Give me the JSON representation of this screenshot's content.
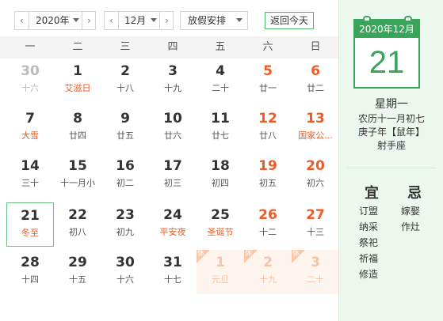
{
  "toolbar": {
    "year": "2020年",
    "month": "12月",
    "holiday_select": "放假安排",
    "today_button": "返回今天",
    "prev_icon": "chevron-left-icon",
    "next_icon": "chevron-right-icon"
  },
  "weekdays": [
    "一",
    "二",
    "三",
    "四",
    "五",
    "六",
    "日"
  ],
  "days": [
    {
      "num": "30",
      "lunar": "十六",
      "type": "other"
    },
    {
      "num": "1",
      "lunar": "艾滋日",
      "type": "festival"
    },
    {
      "num": "2",
      "lunar": "十八",
      "type": "normal"
    },
    {
      "num": "3",
      "lunar": "十九",
      "type": "normal"
    },
    {
      "num": "4",
      "lunar": "二十",
      "type": "normal"
    },
    {
      "num": "5",
      "lunar": "廿一",
      "type": "weekend"
    },
    {
      "num": "6",
      "lunar": "廿二",
      "type": "weekend"
    },
    {
      "num": "7",
      "lunar": "大雪",
      "type": "festival"
    },
    {
      "num": "8",
      "lunar": "廿四",
      "type": "normal"
    },
    {
      "num": "9",
      "lunar": "廿五",
      "type": "normal"
    },
    {
      "num": "10",
      "lunar": "廿六",
      "type": "normal"
    },
    {
      "num": "11",
      "lunar": "廿七",
      "type": "normal"
    },
    {
      "num": "12",
      "lunar": "廿八",
      "type": "weekend"
    },
    {
      "num": "13",
      "lunar": "国家公...",
      "type": "weekend-festival"
    },
    {
      "num": "14",
      "lunar": "三十",
      "type": "normal"
    },
    {
      "num": "15",
      "lunar": "十一月小",
      "type": "normal"
    },
    {
      "num": "16",
      "lunar": "初二",
      "type": "normal"
    },
    {
      "num": "17",
      "lunar": "初三",
      "type": "normal"
    },
    {
      "num": "18",
      "lunar": "初四",
      "type": "normal"
    },
    {
      "num": "19",
      "lunar": "初五",
      "type": "weekend"
    },
    {
      "num": "20",
      "lunar": "初六",
      "type": "weekend"
    },
    {
      "num": "21",
      "lunar": "冬至",
      "type": "today"
    },
    {
      "num": "22",
      "lunar": "初八",
      "type": "normal"
    },
    {
      "num": "23",
      "lunar": "初九",
      "type": "normal"
    },
    {
      "num": "24",
      "lunar": "平安夜",
      "type": "festival"
    },
    {
      "num": "25",
      "lunar": "圣诞节",
      "type": "festival"
    },
    {
      "num": "26",
      "lunar": "十二",
      "type": "weekend"
    },
    {
      "num": "27",
      "lunar": "十三",
      "type": "weekend"
    },
    {
      "num": "28",
      "lunar": "十四",
      "type": "normal"
    },
    {
      "num": "29",
      "lunar": "十五",
      "type": "normal"
    },
    {
      "num": "30",
      "lunar": "十六",
      "type": "normal"
    },
    {
      "num": "31",
      "lunar": "十七",
      "type": "normal"
    },
    {
      "num": "1",
      "lunar": "元旦",
      "type": "holiday",
      "tag": "休"
    },
    {
      "num": "2",
      "lunar": "十九",
      "type": "holiday",
      "tag": "休"
    },
    {
      "num": "3",
      "lunar": "二十",
      "type": "holiday",
      "tag": "休"
    }
  ],
  "detail": {
    "card_header": "2020年12月",
    "card_day": "21",
    "weekday": "星期一",
    "lunar": "农历十一月初七",
    "ganzhi": "庚子年【鼠年】",
    "zodiac": "射手座",
    "yi_label": "宜",
    "ji_label": "忌",
    "yi": [
      "订盟",
      "纳采",
      "祭祀",
      "祈福",
      "修造"
    ],
    "ji": [
      "嫁娶",
      "作灶"
    ]
  },
  "colors": {
    "accent": "#3aa55a",
    "weekend": "#f05b24",
    "holiday_bg": "#fff5ef"
  }
}
